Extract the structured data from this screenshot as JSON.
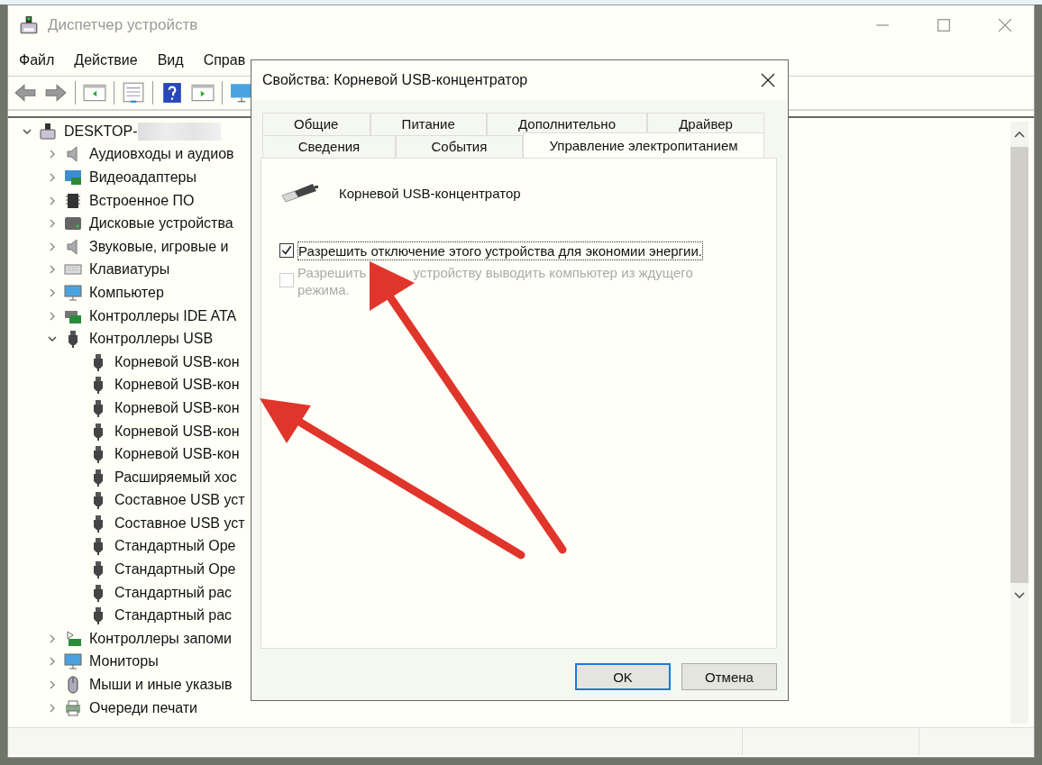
{
  "window": {
    "title": "Диспетчер устройств"
  },
  "menu": [
    "Файл",
    "Действие",
    "Вид",
    "Справ"
  ],
  "tree": {
    "label": "DESKTOP-",
    "expanded": true,
    "children": [
      {
        "label": "Аудиовходы и аудиов",
        "expanded": false
      },
      {
        "label": "Видеоадаптеры",
        "expanded": false
      },
      {
        "label": "Встроенное ПО",
        "expanded": false
      },
      {
        "label": "Дисковые устройства",
        "expanded": false
      },
      {
        "label": "Звуковые, игровые и",
        "expanded": false
      },
      {
        "label": "Клавиатуры",
        "expanded": false
      },
      {
        "label": "Компьютер",
        "expanded": false
      },
      {
        "label": "Контроллеры IDE ATA",
        "expanded": false
      },
      {
        "label": "Контроллеры USB",
        "expanded": true,
        "children": [
          {
            "label": "Корневой USB-кон"
          },
          {
            "label": "Корневой USB-кон"
          },
          {
            "label": "Корневой USB-кон"
          },
          {
            "label": "Корневой USB-кон"
          },
          {
            "label": "Корневой USB-кон"
          },
          {
            "label": "Расширяемый хос"
          },
          {
            "label": "Составное USB уст"
          },
          {
            "label": "Составное USB уст"
          },
          {
            "label": "Стандартный Ope"
          },
          {
            "label": "Стандартный Ope"
          },
          {
            "label": "Стандартный рас"
          },
          {
            "label": "Стандартный рас"
          }
        ]
      },
      {
        "label": "Контроллеры запоми",
        "expanded": false
      },
      {
        "label": "Мониторы",
        "expanded": false
      },
      {
        "label": "Мыши и иные указыв",
        "expanded": false
      },
      {
        "label": "Очереди печати",
        "expanded": false
      }
    ]
  },
  "dialog": {
    "title": "Свойства: Корневой USB-концентратор",
    "tab_rows": [
      [
        {
          "label": "Общие",
          "selected": false
        },
        {
          "label": "Питание",
          "selected": false
        },
        {
          "label": "Дополнительно",
          "selected": false
        },
        {
          "label": "Драйвер",
          "selected": false
        }
      ],
      [
        {
          "label": "Сведения",
          "selected": false
        },
        {
          "label": "События",
          "selected": false
        },
        {
          "label": "Управление электропитанием",
          "selected": true
        }
      ]
    ],
    "device_name": "Корневой USB-концентратор",
    "options": [
      {
        "label": "Разрешить отключение этого устройства для экономии энергии.",
        "checked": true,
        "disabled": false,
        "focused": true
      },
      {
        "label_lines": [
          [
            "Разрешить",
            "устройству выводить компьютер из ждущего"
          ],
          [
            "режима."
          ]
        ],
        "checked": false,
        "disabled": true
      }
    ],
    "buttons": [
      {
        "label": "OK",
        "default": true
      },
      {
        "label": "Отмена",
        "default": false
      }
    ]
  }
}
